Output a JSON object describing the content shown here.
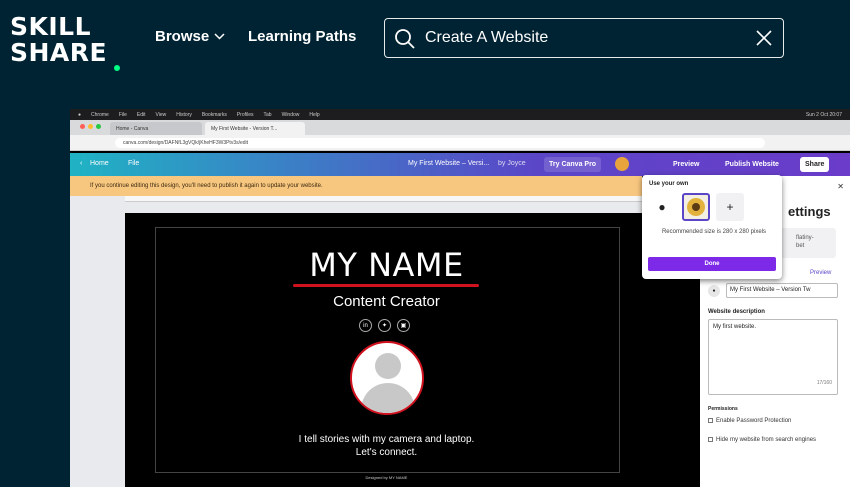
{
  "header": {
    "logo_line1": "SKILL",
    "logo_line2": "SHARE",
    "nav_browse": "Browse",
    "nav_learning_paths": "Learning Paths",
    "search_value": "Create A Website"
  },
  "video": {
    "mac_menu": [
      "Chrome",
      "File",
      "Edit",
      "View",
      "History",
      "Bookmarks",
      "Profiles",
      "Tab",
      "Window",
      "Help"
    ],
    "mac_clock": "Sun 2 Oct 20:07",
    "tabs": [
      "Home - Canva",
      "My First Website - Version T..."
    ],
    "url": "canva.com/design/DAFNfL3gVQk/jKheHF3W3Ptv3s/edit",
    "canva_bar": {
      "home": "Home",
      "file": "File",
      "doc_title": "My First Website – Versi...",
      "by": "by Joyce",
      "try_pro": "Try Canva Pro",
      "preview": "Preview",
      "publish": "Publish Website",
      "share": "Share"
    },
    "warning": "If you continue editing this design, you'll need to publish it again to update your website.",
    "design": {
      "title": "MY NAME",
      "subtitle": "Content Creator",
      "social_icons": [
        "linkedin-icon",
        "twitter-icon",
        "instagram-icon"
      ],
      "tagline_line1": "I tell stories with my camera and laptop.",
      "tagline_line2": "Let's connect.",
      "credit": "Designed by MY NAME"
    },
    "popup": {
      "title": "Use your own",
      "recommended": "Recommended size is 280 x 280 pixels",
      "done": "Done"
    },
    "settings_panel": {
      "heading_fragment": "ettings",
      "name_fragment_1": "flatiny-",
      "name_fragment_2": "bet",
      "preview_link": "Preview",
      "website_title": "My First Website – Version Tw",
      "desc_label": "Website description",
      "desc_value": "My first website.",
      "desc_count": "17/160",
      "permissions_label": "Permissions",
      "option_password": "Enable Password Protection",
      "option_hide": "Hide my website from search engines"
    }
  }
}
